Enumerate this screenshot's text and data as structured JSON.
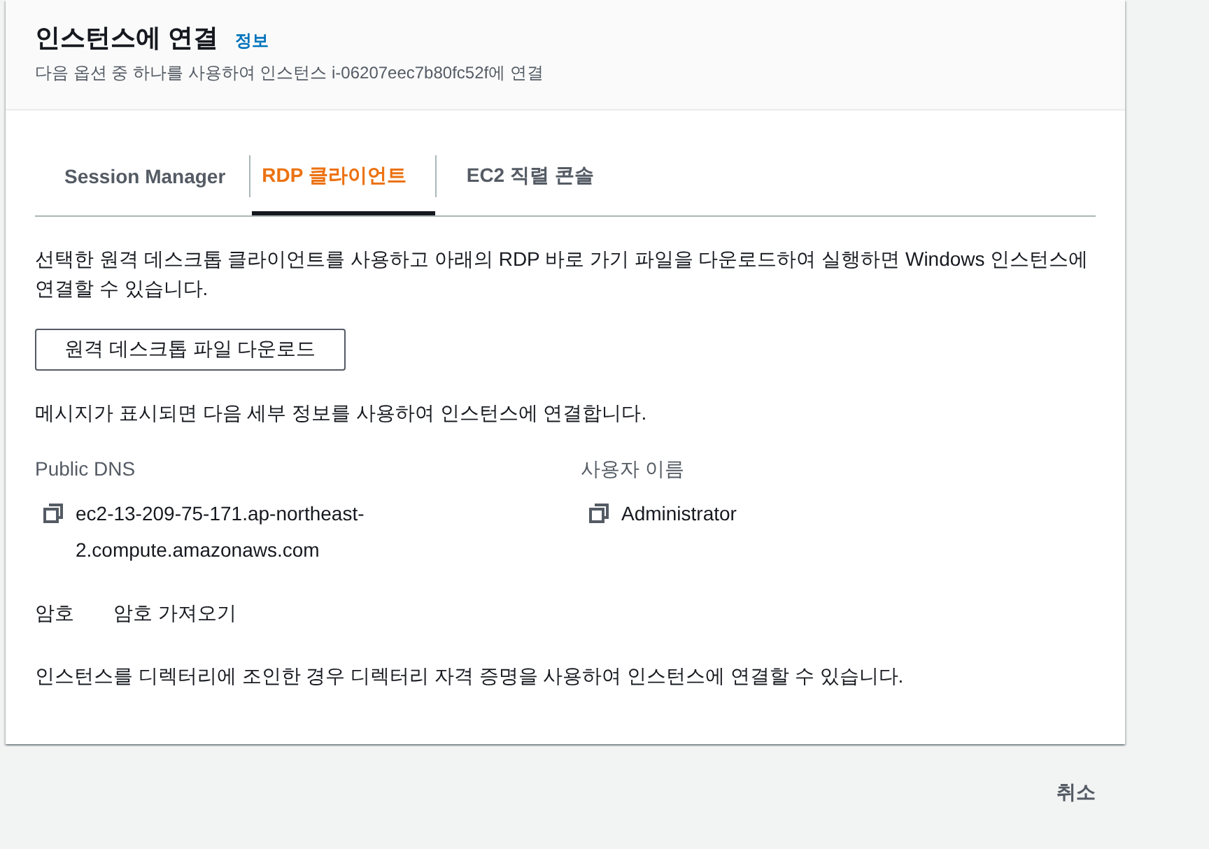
{
  "header": {
    "title": "인스턴스에 연결",
    "info_link": "정보",
    "description": "다음 옵션 중 하나를 사용하여 인스턴스 i-06207eec7b80fc52f에 연결"
  },
  "tabs": [
    {
      "label": "Session Manager",
      "selected": false
    },
    {
      "label": "RDP 클라이언트",
      "selected": true
    },
    {
      "label": "EC2 직렬 콘솔",
      "selected": false
    }
  ],
  "intro": "선택한 원격 데스크톱 클라이언트를 사용하고 아래의 RDP 바로 가기 파일을 다운로드하여 실행하면 Windows 인스턴스에 연결할 수 있습니다.",
  "download_button": "원격 데스크톱 파일 다운로드",
  "prompt_note": "메시지가 표시되면 다음 세부 정보를 사용하여 인스턴스에 연결합니다.",
  "details": [
    {
      "label": "Public DNS",
      "value": "ec2-13-209-75-171.ap-northeast-2.compute.amazonaws.com"
    },
    {
      "label": "사용자 이름",
      "value": "Administrator"
    }
  ],
  "password": {
    "label": "암호",
    "button": "암호 가져오기"
  },
  "directory_note": "인스턴스를 디렉터리에 조인한 경우 디렉터리 자격 증명을 사용하여 인스턴스에 연결할 수 있습니다.",
  "footer": {
    "cancel_button": "취소"
  }
}
